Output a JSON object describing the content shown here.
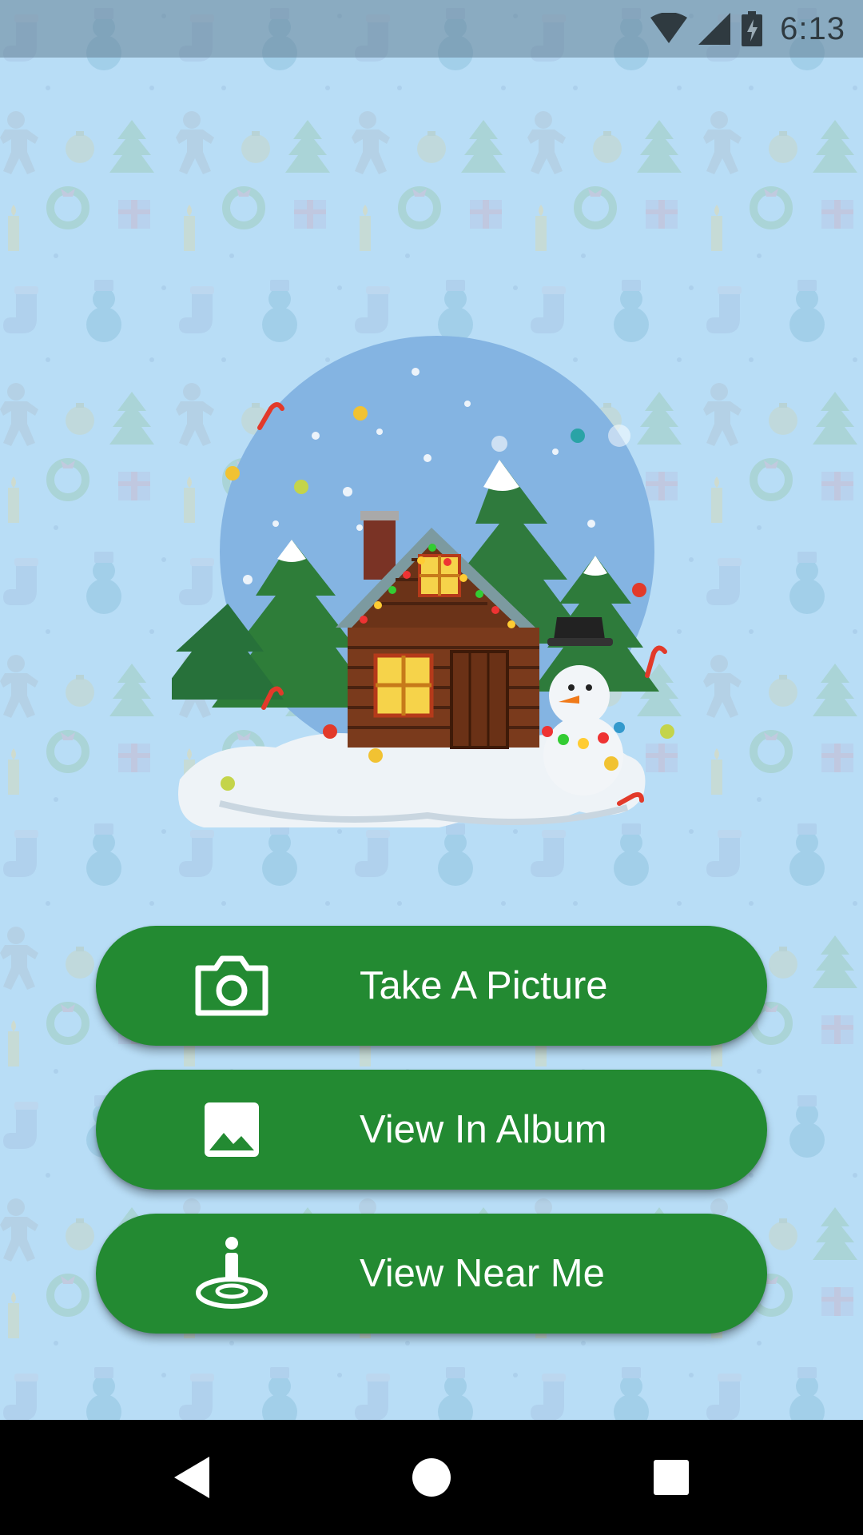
{
  "status_bar": {
    "time": "6:13",
    "icons": [
      "wifi-icon",
      "cellular-signal-icon",
      "battery-charging-icon"
    ]
  },
  "hero": {
    "image": "christmas-cabin-snowman-illustration"
  },
  "actions": {
    "take_picture_label": "Take A Picture",
    "view_album_label": "View In Album",
    "view_near_me_label": "View Near Me",
    "icons": [
      "camera-icon",
      "image-icon",
      "location-person-icon"
    ]
  },
  "nav_bar": {
    "icons": [
      "back-icon",
      "home-icon",
      "recents-icon"
    ]
  },
  "colors": {
    "background": "#b8ddf6",
    "button": "#238a32",
    "button_text": "#ffffff",
    "nav_bar": "#000000"
  }
}
